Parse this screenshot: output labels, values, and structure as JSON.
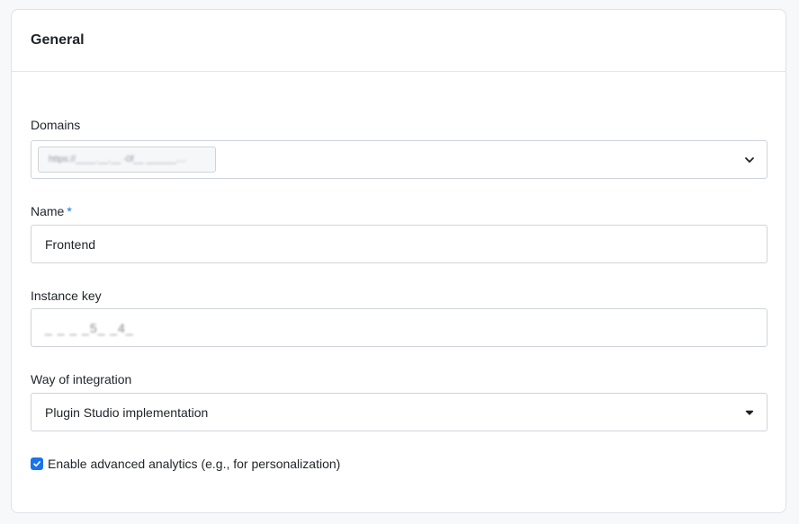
{
  "section": {
    "title": "General"
  },
  "domains": {
    "label": "Domains",
    "chip_text": "https://____.__.__ -0f__ ______....",
    "icon": "chevron-down-icon"
  },
  "name": {
    "label": "Name",
    "required_marker": "*",
    "value": "Frontend"
  },
  "instance_key": {
    "label": "Instance key",
    "value": "_ _ _ _5_ _4_"
  },
  "integration": {
    "label": "Way of integration",
    "selected": "Plugin Studio implementation",
    "icon": "chevron-down-icon"
  },
  "analytics": {
    "checked": true,
    "label": "Enable advanced analytics (e.g., for personalization)",
    "icon": "checkmark-icon"
  },
  "colors": {
    "accent": "#1a73e8",
    "border": "#cfd4da",
    "background": "#f7f8fa"
  }
}
